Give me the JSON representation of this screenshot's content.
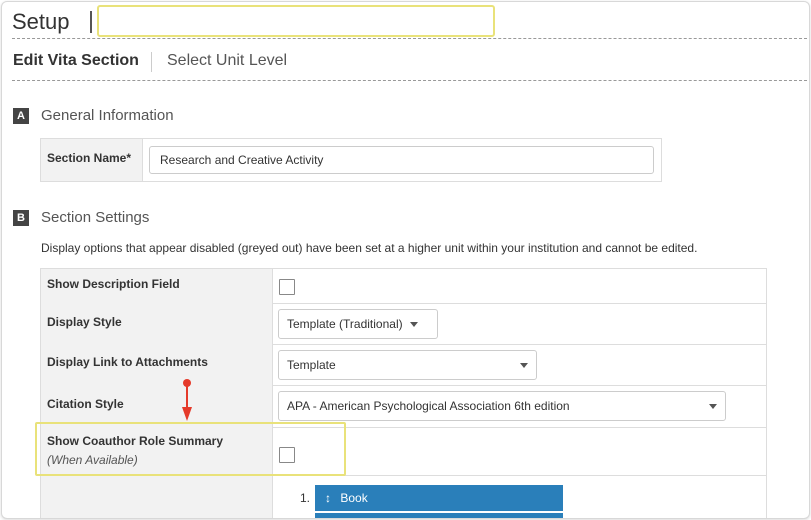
{
  "header": {
    "title": "Setup",
    "search_value": ""
  },
  "nav": {
    "edit_label": "Edit Vita Section",
    "select_label": "Select Unit Level"
  },
  "general": {
    "badge": "A",
    "title": "General Information",
    "section_name_label": "Section Name*",
    "section_name_value": "Research and Creative Activity"
  },
  "settings": {
    "badge": "B",
    "title": "Section Settings",
    "info": "Display options that appear disabled (greyed out) have been set at a higher unit within your institution and cannot be edited.",
    "rows": [
      {
        "label": "Show Description Field",
        "control": "checkbox",
        "checked": false
      },
      {
        "label": "Display Style",
        "control": "select",
        "value": "Template (Traditional)"
      },
      {
        "label": "Display Link to Attachments",
        "control": "select",
        "value": "Template"
      },
      {
        "label": "Citation Style",
        "control": "select",
        "value": "APA - American Psychological Association 6th edition"
      },
      {
        "label": "Show Coauthor Role Summary",
        "sublabel": "(When Available)",
        "control": "checkbox",
        "checked": false
      }
    ],
    "order_list": [
      {
        "number": "1.",
        "handle": "↕",
        "label": "Book"
      }
    ]
  },
  "colors": {
    "highlight": "#e9e27a",
    "annotation_arrow": "#e53a2a",
    "pill": "#2a7fba",
    "badge": "#444444"
  }
}
